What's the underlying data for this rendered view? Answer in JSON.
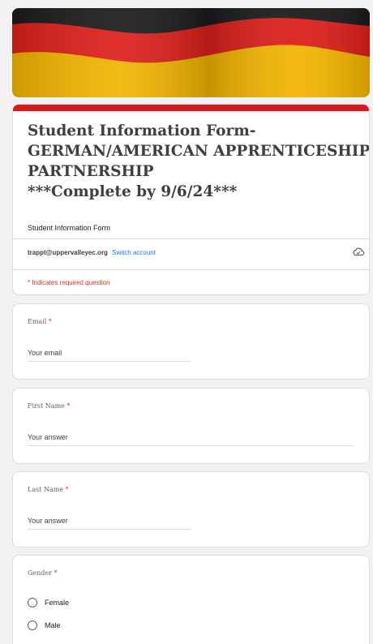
{
  "form": {
    "title_lines": [
      "Student Information Form-",
      "GERMAN/AMERICAN APPRENTICESHIP",
      "PARTNERSHIP",
      "***Complete by 9/6/24***"
    ],
    "subtitle": "Student Information Form",
    "account_email": "trappt@uppervalleyec.org",
    "switch_account": "Switch account",
    "required_note": "* Indicates required question",
    "accent_color": "#d71a1a"
  },
  "questions": [
    {
      "label": "Email",
      "required_mark": "*",
      "placeholder": "Your email"
    },
    {
      "label": "First Name",
      "required_mark": "*",
      "placeholder": "Your answer"
    },
    {
      "label": "Last Name",
      "required_mark": "*",
      "placeholder": "Your answer"
    }
  ],
  "gender": {
    "label": "Gender",
    "required_mark": "*",
    "options": [
      "Female",
      "Male"
    ]
  },
  "icons": {
    "banner": "german-flag-banner",
    "cloud": "cloud-save-icon"
  }
}
